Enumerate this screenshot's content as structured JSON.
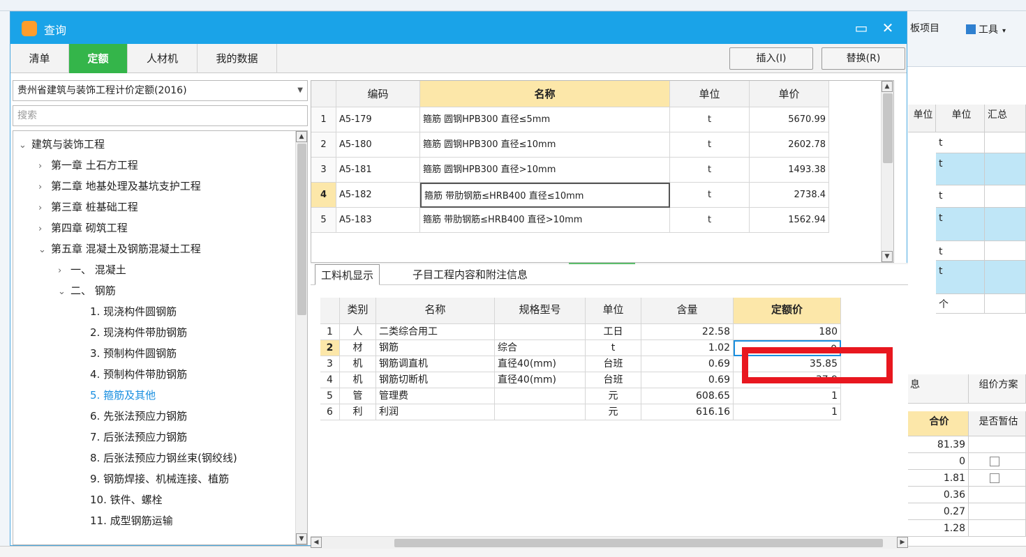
{
  "dialog": {
    "title": "查询"
  },
  "tabs": [
    "清单",
    "定额",
    "人材机",
    "我的数据"
  ],
  "active_tab": 1,
  "buttons": {
    "insert": "插入(I)",
    "replace": "替换(R)"
  },
  "combo": {
    "value": "贵州省建筑与装饰工程计价定额(2016)"
  },
  "search": {
    "placeholder": "搜索"
  },
  "tree": [
    {
      "label": "建筑与装饰工程",
      "level": 0,
      "chevron": "v"
    },
    {
      "label": "第一章 土石方工程",
      "level": 1,
      "chevron": ">"
    },
    {
      "label": "第二章 地基处理及基坑支护工程",
      "level": 1,
      "chevron": ">"
    },
    {
      "label": "第三章 桩基础工程",
      "level": 1,
      "chevron": ">"
    },
    {
      "label": "第四章 砌筑工程",
      "level": 1,
      "chevron": ">"
    },
    {
      "label": "第五章 混凝土及钢筋混凝土工程",
      "level": 1,
      "chevron": "v"
    },
    {
      "label": "一、 混凝土",
      "level": 2,
      "chevron": ">"
    },
    {
      "label": "二、 钢筋",
      "level": 2,
      "chevron": "v"
    },
    {
      "label": "1. 现浇构件圆钢筋",
      "level": 3,
      "chevron": ""
    },
    {
      "label": "2. 现浇构件带肋钢筋",
      "level": 3,
      "chevron": ""
    },
    {
      "label": "3. 预制构件圆钢筋",
      "level": 3,
      "chevron": ""
    },
    {
      "label": "4. 预制构件带肋钢筋",
      "level": 3,
      "chevron": ""
    },
    {
      "label": "5. 箍筋及其他",
      "level": 3,
      "chevron": "",
      "selected": true
    },
    {
      "label": "6. 先张法预应力钢筋",
      "level": 3,
      "chevron": ""
    },
    {
      "label": "7. 后张法预应力钢筋",
      "level": 3,
      "chevron": ""
    },
    {
      "label": "8. 后张法预应力钢丝束(钢绞线)",
      "level": 3,
      "chevron": ""
    },
    {
      "label": "9. 钢筋焊接、机械连接、植筋",
      "level": 3,
      "chevron": ""
    },
    {
      "label": "10. 铁件、螺栓",
      "level": 3,
      "chevron": ""
    },
    {
      "label": "11. 成型钢筋运输",
      "level": 3,
      "chevron": ""
    }
  ],
  "quota_table": {
    "headers": [
      "",
      "编码",
      "名称",
      "单位",
      "单价"
    ],
    "rows": [
      [
        "1",
        "A5-179",
        "箍筋 圆钢HPB300 直径≤5mm",
        "t",
        "5670.99"
      ],
      [
        "2",
        "A5-180",
        "箍筋 圆钢HPB300 直径≤10mm",
        "t",
        "2602.78"
      ],
      [
        "3",
        "A5-181",
        "箍筋 圆钢HPB300 直径>10mm",
        "t",
        "1493.38"
      ],
      [
        "4",
        "A5-182",
        "箍筋 带肋钢筋≤HRB400 直径≤10mm",
        "t",
        "2738.4"
      ],
      [
        "5",
        "A5-183",
        "箍筋 带肋钢筋≤HRB400 直径>10mm",
        "t",
        "1562.94"
      ]
    ]
  },
  "subtabs": [
    "工料机显示",
    "子目工程内容和附注信息"
  ],
  "resource_table": {
    "headers": [
      "",
      "类别",
      "名称",
      "规格型号",
      "单位",
      "含量",
      "定额价"
    ],
    "rows": [
      [
        "1",
        "人",
        "二类综合用工",
        "",
        "工日",
        "22.58",
        "180"
      ],
      [
        "2",
        "材",
        "钢筋",
        "综合",
        "t",
        "1.02",
        "0"
      ],
      [
        "3",
        "机",
        "钢筋调直机",
        "直径40(mm)",
        "台班",
        "0.69",
        "35.85"
      ],
      [
        "4",
        "机",
        "钢筋切断机",
        "直径40(mm)",
        "台班",
        "0.69",
        "37.9"
      ],
      [
        "5",
        "管",
        "管理费",
        "",
        "元",
        "608.65",
        "1"
      ],
      [
        "6",
        "利",
        "利润",
        "",
        "元",
        "616.16",
        "1"
      ]
    ]
  },
  "background": {
    "ribbon": {
      "template_item": "板项目",
      "tools": "工具"
    },
    "unit_header": "单位",
    "summary_header": "汇总",
    "units": [
      "t",
      "t",
      "t",
      "t",
      "t",
      "t",
      "个"
    ],
    "tabs": [
      "息",
      "组价方案"
    ],
    "price_headers": [
      "合价",
      "是否暂估"
    ],
    "prices": [
      "81.39",
      "0",
      "1.81",
      "0.36",
      "0.27",
      "1.28"
    ]
  }
}
